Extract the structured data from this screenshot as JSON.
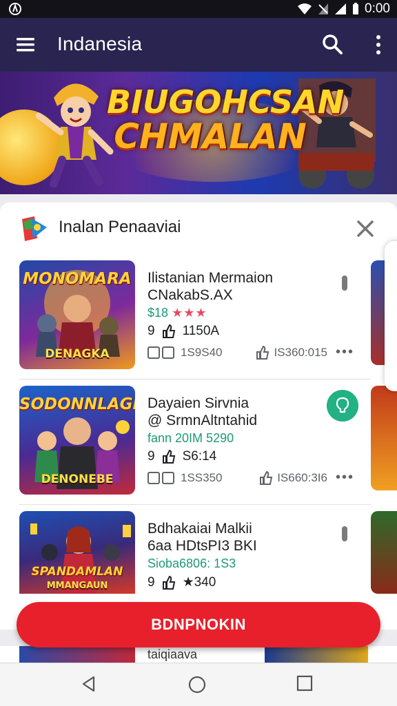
{
  "status_bar": {
    "time": "0:00"
  },
  "app_bar": {
    "title": "Indanesia"
  },
  "banner": {
    "title_line1": "BIUGOHCSAN",
    "title_line2": "CHMALAN"
  },
  "card": {
    "header_title": "Inalan Penaaviai",
    "items": [
      {
        "thumb_title": "MONOMARA",
        "thumb_bottom": "DENAGKA",
        "line1": "Ilistanian Mermaion",
        "line2": "CNakabS.AX",
        "rating_text": "$18",
        "stars": "★★★",
        "likes": "9",
        "count": "1150A",
        "stat_left": "1S9S40",
        "stat_right": "IS360:015",
        "accent": "#f2a621"
      },
      {
        "thumb_title": "SODONNLAGN",
        "thumb_bottom": "DENONEBE",
        "line1": "Dayaien Sirvnia",
        "line2": "@ SrmnAltntahid",
        "rating_text": "fann 20IM 5290",
        "stars": "",
        "likes": "9",
        "count": "S6:14",
        "stat_left": "1SS350",
        "stat_right": "IS660:3I6",
        "accent": "#3f57c5"
      },
      {
        "thumb_title": "SPANDAMLAN",
        "thumb_bottom": "MMANGAUN",
        "line1": "Bdhakaiai Malkii",
        "line2": "6aa HDtsPI3 BKI",
        "rating_text": "Sioba6806: 1S3",
        "stars": "",
        "likes": "9",
        "count": "★340",
        "stat_left": "",
        "stat_right": "",
        "accent": "#d33a2c"
      }
    ]
  },
  "bottom_button": {
    "label": "BDNPNOKIN"
  },
  "below_button_text": "taiqiaava",
  "colors": {
    "app_bar": "#2a2450",
    "accent_red": "#e8202b",
    "rating_green": "#1d9a76",
    "badge_green": "#21b184"
  }
}
